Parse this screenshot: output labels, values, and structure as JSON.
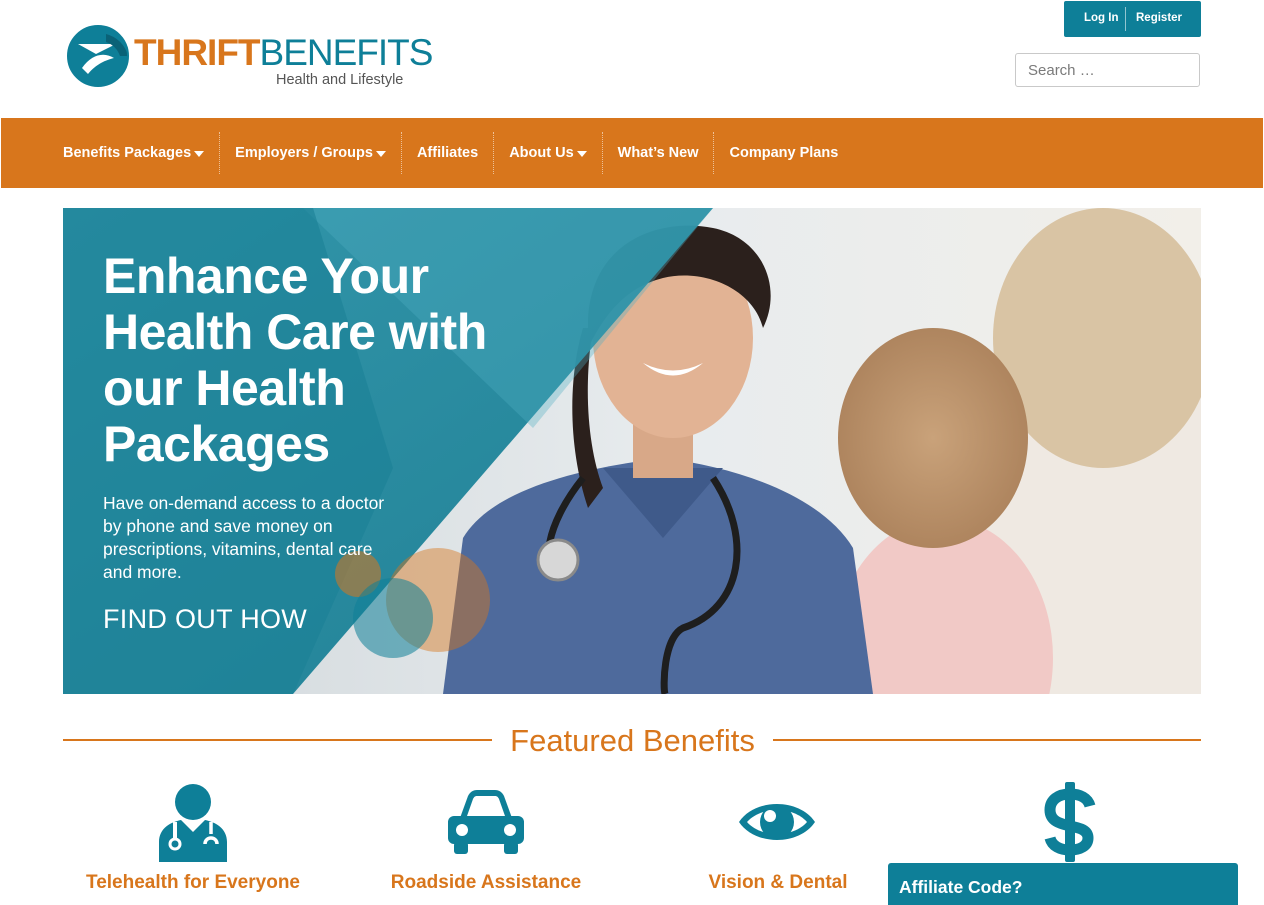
{
  "brand": {
    "name_part1": "THRIFT",
    "name_part2": "BENEFITS",
    "tagline": "Health and Lifestyle",
    "primary_color": "#0e7f98",
    "accent_color": "#d8761c"
  },
  "auth": {
    "login_label": "Log In",
    "register_label": "Register"
  },
  "search": {
    "placeholder": "Search …"
  },
  "nav": {
    "items": [
      {
        "label": "Benefits Packages",
        "has_dropdown": true
      },
      {
        "label": "Employers / Groups",
        "has_dropdown": true
      },
      {
        "label": "Affiliates",
        "has_dropdown": false
      },
      {
        "label": "About Us",
        "has_dropdown": true
      },
      {
        "label": "What’s New",
        "has_dropdown": false
      },
      {
        "label": "Company Plans",
        "has_dropdown": false
      }
    ]
  },
  "hero": {
    "title": "Enhance Your Health Care with our Health Packages",
    "text": "Have on-demand access to a doctor by phone and save money on prescriptions, vitamins, dental care and more.",
    "cta": "FIND OUT HOW"
  },
  "featured": {
    "title": "Featured Benefits",
    "items": [
      {
        "label": "Telehealth for Everyone",
        "icon": "doctor-icon"
      },
      {
        "label": "Roadside Assistance",
        "icon": "car-icon"
      },
      {
        "label": "Vision & Dental",
        "icon": "eye-icon"
      },
      {
        "label": "",
        "icon": "dollar-icon"
      }
    ]
  },
  "affiliate": {
    "label": "Affiliate Code?"
  }
}
